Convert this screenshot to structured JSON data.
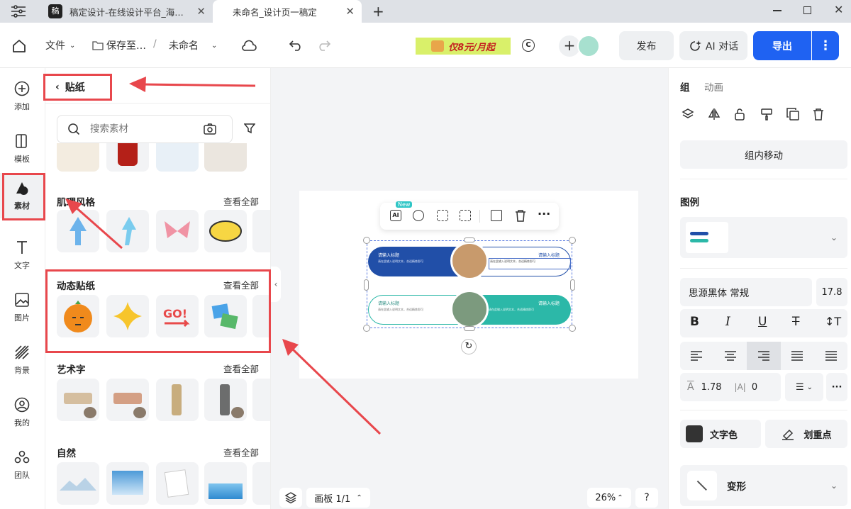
{
  "tabs": [
    {
      "label": "稿定设计-在线设计平台_海…"
    },
    {
      "label": "未命名_设计页一稿定"
    }
  ],
  "toolbar": {
    "file": "文件",
    "save": "保存至…",
    "slash": "/",
    "doc_name": "未命名",
    "promo_text": "仅8元/月起",
    "publish": "发布",
    "ai_chat": "AI 对话",
    "export": "导出"
  },
  "nav": [
    {
      "label": "添加"
    },
    {
      "label": "模板"
    },
    {
      "label": "素材"
    },
    {
      "label": "文字"
    },
    {
      "label": "图片"
    },
    {
      "label": "背景"
    },
    {
      "label": "我的"
    },
    {
      "label": "团队"
    }
  ],
  "panel": {
    "back_label": "贴纸",
    "search_placeholder": "搜索素材",
    "sections": [
      {
        "title": "肌理风格",
        "more": "查看全部"
      },
      {
        "title": "动态贴纸",
        "more": "查看全部"
      },
      {
        "title": "艺术字",
        "more": "查看全部"
      },
      {
        "title": "自然",
        "more": "查看全部"
      }
    ]
  },
  "canvas": {
    "new_badge": "New",
    "row1_title_left": "请输入标题",
    "row1_title_right": "请输入标题",
    "row2_title_left": "请输入标题",
    "row2_title_right": "请输入标题",
    "body_text": "请在此输入说明文本，合适精炼即可",
    "board_label": "画板 1/1",
    "zoom": "26%",
    "help": "?"
  },
  "right": {
    "tab_group": "组",
    "tab_anim": "动画",
    "move_in_group": "组内移动",
    "legend_title": "图例",
    "font_name": "思源黑体 常规",
    "font_size": "17.8",
    "line_height": "1.78",
    "letter_spacing": "0",
    "text_color": "文字色",
    "highlight": "划重点",
    "transform": "变形"
  }
}
